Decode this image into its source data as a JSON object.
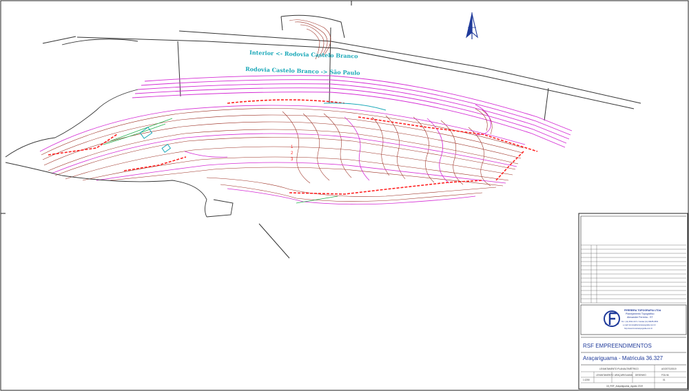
{
  "drawing": {
    "road_labels": [
      "Interior <- Rodovia Castelo Branco",
      "Rodovia Castelo Branco -> São Paulo"
    ],
    "red_labels": [
      "1",
      "2",
      "3"
    ],
    "title_block": {
      "company": {
        "name": "FERREIRA TOPOGRAFIA LTDA",
        "service": "Planejamento Topográfico",
        "person": "Alexandre Ferreira - ST",
        "phone": "Tel.: (11) 4631-0171 / Celular (11) 99185-6563",
        "email": "e-mail: ferreira@ferreiratopografia.com.br",
        "site": "http://www.ferreiratopografia.com.br"
      },
      "client": "RSF EMPREENDIMENTOS",
      "location": "Araçariguama - Matricula 36.327",
      "drawing_title": "LEVANTAMENTO PLANIALTIMÉTRICO",
      "date": "AGOSTO/2019",
      "scale": "1:1250",
      "sheet": "01",
      "file": "18_RSF_Araçariguama_Agosto 2019",
      "cells": [
        "LEVANTAMENTO",
        "ARAÇARIGUAMA",
        "DESENHO",
        "FOLHA"
      ]
    }
  },
  "colors": {
    "contour_magenta": "#d42ad4",
    "contour_brown": "#9a2b1f",
    "labels_red": "#ff2020",
    "road_text_cyan": "#1aa8b8",
    "company_blue": "#1f3a9a"
  },
  "icons": [
    "north-arrow-icon",
    "company-logo"
  ]
}
